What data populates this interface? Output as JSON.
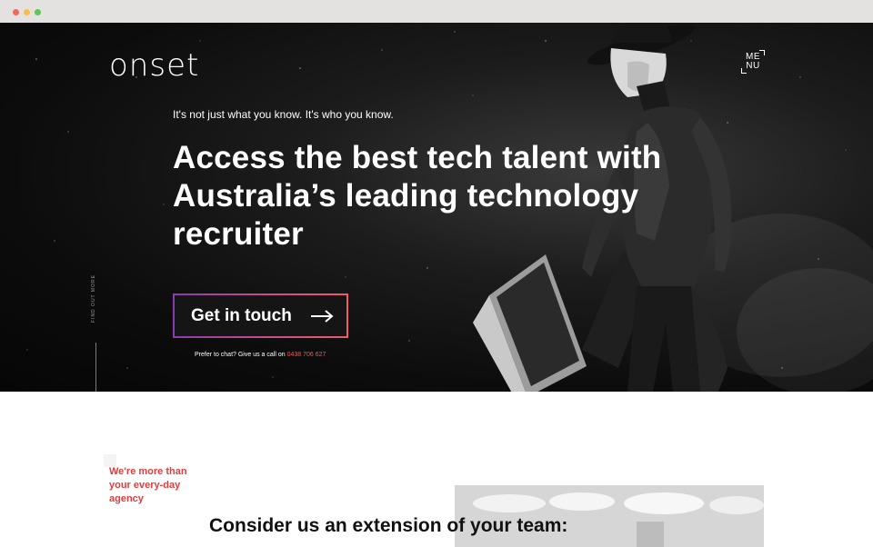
{
  "browser": {
    "window_controls": [
      "close",
      "minimize",
      "maximize"
    ]
  },
  "header": {
    "logo": "onset",
    "menu_label": "ME NU"
  },
  "hero": {
    "eyebrow": "It's not just what you know. It's who you know.",
    "headline": "Access the best tech talent with Australia’s leading technology recruiter",
    "cta_label": "Get in touch",
    "chat_prefix": "Prefer to chat? Give us a call on",
    "phone": "0438 706 627",
    "side_label": "FIND OUT MORE"
  },
  "section": {
    "tagline": "We're more than your every-day agency",
    "title": "Consider us an extension of your team:"
  },
  "colors": {
    "accent_red": "#e23b3b",
    "cta_gradient_start": "#8a3ab0",
    "cta_gradient_end": "#f05a6b",
    "hero_bg": "#0c0c0c"
  }
}
